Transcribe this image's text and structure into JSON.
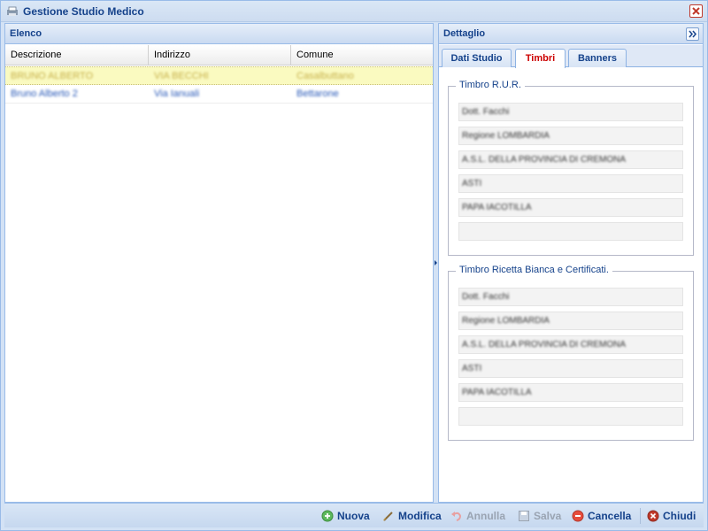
{
  "window": {
    "title": "Gestione Studio Medico"
  },
  "elenco": {
    "title": "Elenco",
    "columns": [
      "Descrizione",
      "Indirizzo",
      "Comune"
    ],
    "rows": [
      {
        "descrizione": "BRUNO ALBERTO",
        "indirizzo": "VIA BECCHI",
        "comune": "Casalbuttano"
      },
      {
        "descrizione": "Bruno Alberto 2",
        "indirizzo": "Via Ianuali",
        "comune": "Bettarone"
      }
    ]
  },
  "dettaglio": {
    "title": "Dettaglio",
    "tabs": [
      "Dati Studio",
      "Timbri",
      "Banners"
    ],
    "active_tab": "Timbri",
    "timbro_rur": {
      "legend": "Timbro R.U.R.",
      "lines": [
        "Dott. Facchi",
        "Regione LOMBARDIA",
        "A.S.L. DELLA PROVINCIA DI CREMONA",
        "ASTI",
        "PAPA IACOTILLA",
        ""
      ]
    },
    "timbro_ricetta": {
      "legend": "Timbro Ricetta Bianca e Certificati.",
      "lines": [
        "Dott. Facchi",
        "Regione LOMBARDIA",
        "A.S.L. DELLA PROVINCIA DI CREMONA",
        "ASTI",
        "PAPA IACOTILLA",
        ""
      ]
    }
  },
  "footer": {
    "nuova": "Nuova",
    "modifica": "Modifica",
    "annulla": "Annulla",
    "salva": "Salva",
    "cancella": "Cancella",
    "chiudi": "Chiudi"
  },
  "colors": {
    "header_text": "#15428b",
    "active_tab": "#cc0000",
    "selected_row": "#fafac0"
  }
}
